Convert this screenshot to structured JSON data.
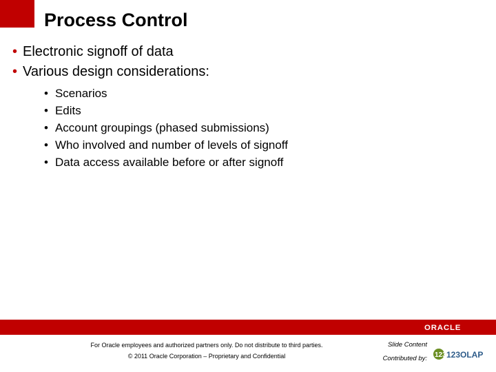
{
  "title": "Process Control",
  "bullets_l1": [
    "Electronic signoff of data",
    "Various design considerations:"
  ],
  "bullets_l2": [
    "Scenarios",
    "Edits",
    "Account groupings (phased submissions)",
    "Who involved and number of levels of signoff",
    "Data access available before or after signoff"
  ],
  "footer": {
    "line1": "For Oracle employees and authorized partners only. Do not distribute to third parties.",
    "line2": "© 2011 Oracle Corporation – Proprietary and Confidential",
    "slide_content_label": "Slide Content",
    "contributed_by_label": "Contributed by:",
    "oracle_wordmark": "ORACLE",
    "olap_wordmark": "123OLAP"
  }
}
